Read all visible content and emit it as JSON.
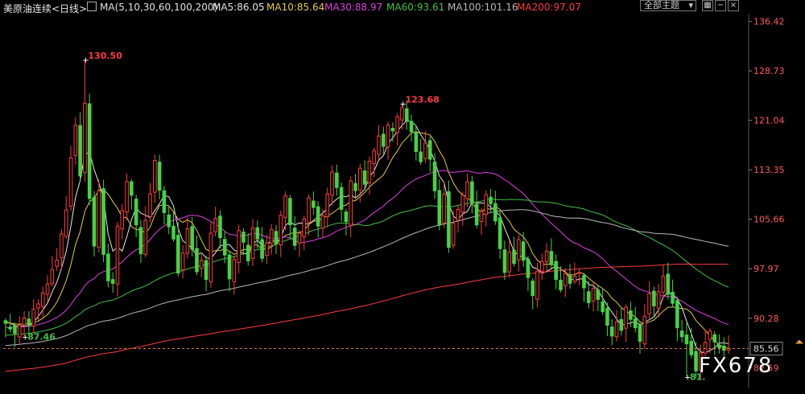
{
  "header": {
    "title": "美原油连续<日线>",
    "ma_label": "MA(5,10,30,60,100,200)",
    "ma5": "MA5:86.05",
    "ma10": "MA10:85.64",
    "ma30": "MA30:88.97",
    "ma60": "MA60:93.61",
    "ma100": "MA100:101.16",
    "ma200": "MA200:97.07",
    "theme_label": "全部主题",
    "colors": {
      "ma5": "#e6e6e6",
      "ma10": "#e6c84a",
      "ma30": "#e040e0",
      "ma60": "#43c043",
      "ma100": "#b8b8b8",
      "ma200": "#ff3c3c"
    }
  },
  "toolbar": {
    "buttons": [
      "grid-icon",
      "minus-icon",
      "close-icon"
    ]
  },
  "watermark": "FX678",
  "chart_data": {
    "type": "candlestick",
    "ylim": [
      79.5,
      137.5
    ],
    "y_ticks": [
      "136.42",
      "128.73",
      "121.04",
      "113.35",
      "105.66",
      "97.97",
      "90.28",
      "82.59"
    ],
    "current_price": "85.56",
    "annotations": [
      {
        "text": "130.50",
        "value": 130.5,
        "color": "#ff3c3c"
      },
      {
        "text": "123.68",
        "value": 123.68,
        "color": "#ff3c3c"
      },
      {
        "text": "87.46",
        "value": 87.46,
        "color": "#43c043"
      },
      {
        "text": "81.",
        "value": 81.2,
        "color": "#43c043"
      }
    ],
    "closes": [
      89.5,
      88.6,
      87.9,
      89.2,
      90.3,
      89.1,
      91.7,
      92.5,
      94.2,
      95.6,
      97.8,
      99.3,
      103.4,
      107.1,
      115.2,
      120.3,
      112.4,
      123.7,
      108.9,
      101.5,
      110.1,
      100.2,
      96.1,
      95.7,
      104.6,
      107.0,
      111.5,
      109.4,
      104.8,
      100.3,
      105.5,
      109.6,
      114.8,
      110.2,
      106.7,
      104.5,
      102.6,
      97.3,
      100.4,
      104.2,
      101.0,
      97.5,
      99.3,
      96.3,
      103.5,
      105.8,
      102.8,
      100.1,
      96.4,
      99.4,
      103.9,
      102.1,
      99.2,
      104.3,
      102.6,
      99.6,
      102.0,
      104.1,
      101.9,
      106.3,
      109.3,
      104.8,
      101.6,
      103.5,
      105.7,
      109.0,
      107.5,
      104.6,
      106.2,
      109.6,
      113.0,
      110.6,
      107.2,
      105.3,
      111.6,
      110.1,
      113.6,
      111.1,
      114.7,
      116.3,
      118.6,
      117.0,
      120.3,
      119.4,
      121.6,
      123.0,
      120.9,
      119.3,
      116.2,
      114.6,
      117.5,
      115.0,
      110.1,
      104.8,
      109.6,
      101.3,
      105.0,
      107.2,
      109.4,
      111.5,
      108.3,
      104.8,
      106.9,
      109.5,
      108.1,
      105.4,
      101.1,
      97.4,
      100.6,
      98.8,
      102.5,
      99.3,
      96.6,
      93.8,
      97.6,
      99.1,
      100.7,
      98.6,
      96.3,
      94.7,
      97.2,
      95.7,
      96.8,
      97.4,
      95.0,
      92.7,
      94.9,
      93.2,
      91.3,
      89.2,
      87.5,
      89.7,
      88.4,
      92.0,
      90.1,
      88.8,
      86.7,
      90.6,
      94.1,
      92.2,
      94.4,
      96.8,
      94.0,
      92.6,
      88.8,
      87.4,
      86.3,
      84.6,
      82.1,
      84.9,
      86.5,
      88.3,
      86.6,
      85.7,
      85.3,
      85.6
    ],
    "ma_series": [
      {
        "name": "MA5",
        "color": "#e6e6e6"
      },
      {
        "name": "MA10",
        "color": "#e6c84a"
      },
      {
        "name": "MA30",
        "color": "#e040e0"
      },
      {
        "name": "MA60",
        "color": "#43c043"
      },
      {
        "name": "MA100",
        "color": "#b8b8b8"
      },
      {
        "name": "MA200",
        "color": "#ff3c3c"
      }
    ]
  }
}
